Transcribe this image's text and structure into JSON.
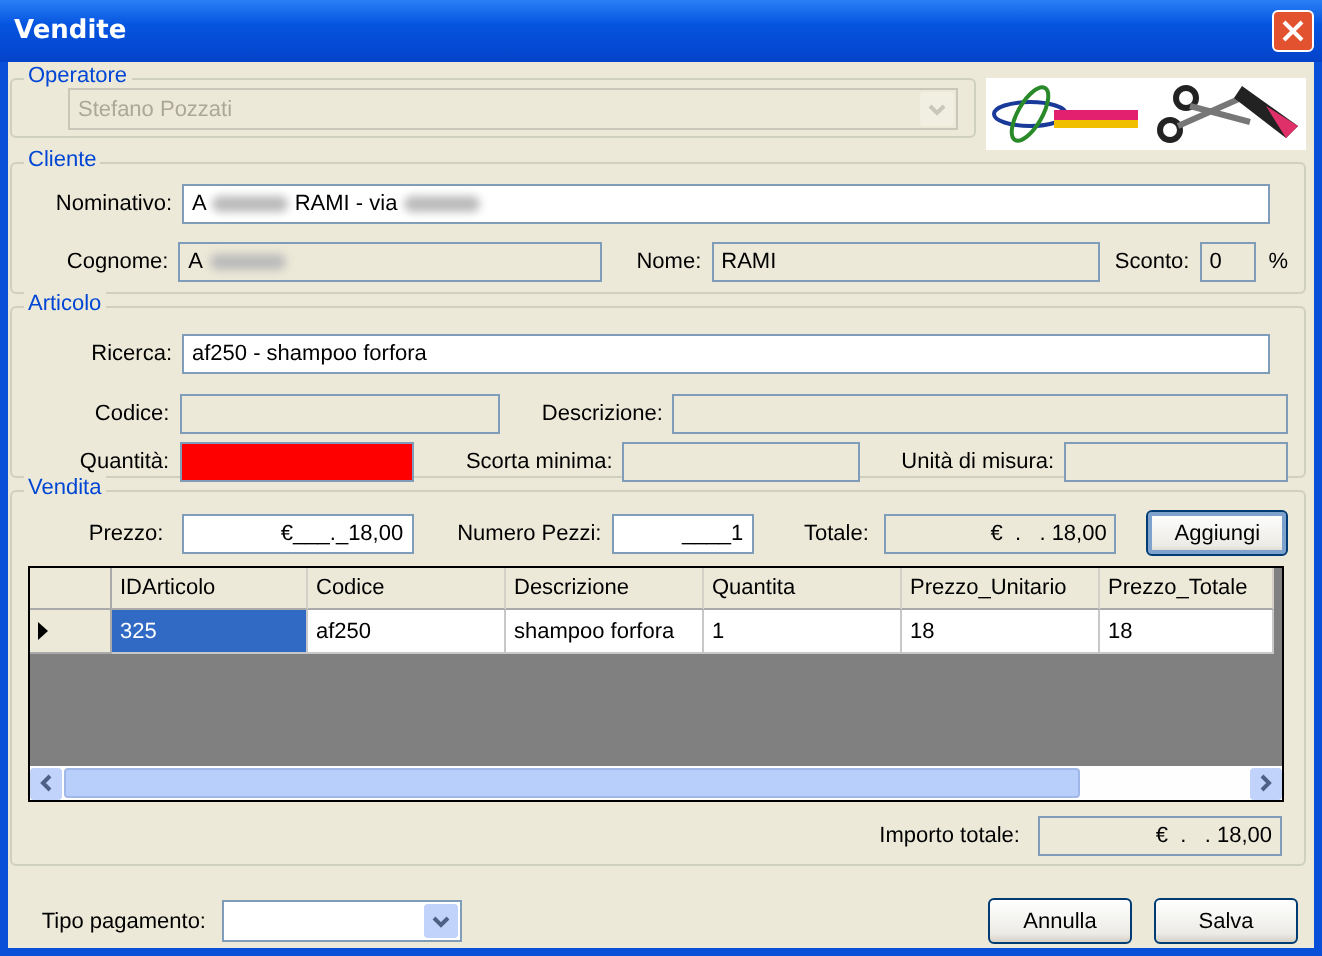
{
  "window": {
    "title": "Vendite"
  },
  "operatore": {
    "legend": "Operatore",
    "value": "Stefano Pozzati",
    "disabled": true
  },
  "cliente": {
    "legend": "Cliente",
    "nominativo": {
      "label": "Nominativo:",
      "before": "A",
      "after": "RAMI - via"
    },
    "cognome": {
      "label": "Cognome:",
      "value": "A"
    },
    "nome": {
      "label": "Nome:",
      "value": "RAMI"
    },
    "sconto": {
      "label": "Sconto:",
      "value": "0",
      "unit": "%"
    }
  },
  "articolo": {
    "legend": "Articolo",
    "ricerca": {
      "label": "Ricerca:",
      "value": "af250 - shampoo forfora"
    },
    "codice": {
      "label": "Codice:"
    },
    "descrizione": {
      "label": "Descrizione:"
    },
    "quantita": {
      "label": "Quantità:",
      "color": "#ff0000"
    },
    "scorta": {
      "label": "Scorta minima:"
    },
    "unita": {
      "label": "Unità di misura:"
    }
  },
  "vendita": {
    "legend": "Vendita",
    "prezzo": {
      "label": "Prezzo:",
      "value": "€___._18,00"
    },
    "pezzi": {
      "label": "Numero Pezzi:",
      "value": "____1"
    },
    "totale": {
      "label": "Totale:",
      "value": "€  .   . 18,00"
    },
    "add_button": "Aggiungi",
    "table": {
      "columns": [
        "IDArticolo",
        "Codice",
        "Descrizione",
        "Quantita",
        "Prezzo_Unitario",
        "Prezzo_Totale"
      ],
      "rows": [
        {
          "current": true,
          "cells": [
            {
              "text": "325",
              "selected": true
            },
            {
              "text": "af250",
              "selected": false
            },
            {
              "text": "shampoo forfora",
              "selected": false
            },
            {
              "text": "1",
              "selected": false
            },
            {
              "text": "18",
              "selected": false
            },
            {
              "text": "18",
              "selected": false
            }
          ]
        }
      ]
    },
    "importo": {
      "label": "Importo totale:",
      "value": "€  .   . 18,00"
    }
  },
  "pagamento": {
    "label": "Tipo pagamento:"
  },
  "buttons": [
    "Annulla",
    "Salva"
  ]
}
